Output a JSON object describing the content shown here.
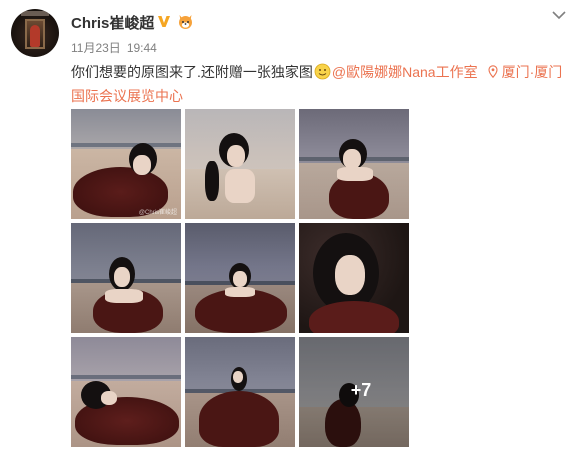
{
  "post": {
    "username": "Chris崔峻超",
    "date": "11月23日",
    "time": "19:44",
    "text_part1": "你们想要的原图来了.还附赠一张独家图",
    "mention": "@歐陽娜娜Nana工作室",
    "location": "厦门·厦门国际会议展览中心"
  },
  "gallery": {
    "more_count": "+7",
    "watermark": "@Chris崔峻超"
  },
  "colors": {
    "accent": "#eb7350",
    "verified": "#f5a623",
    "meta_gray": "#808080"
  },
  "icons": {
    "verified": "verified-v-icon",
    "emoji": "fox-emoji-icon",
    "dropdown": "chevron-down-icon",
    "location": "location-pin-icon",
    "smiley": "smiley-emoji-icon"
  }
}
